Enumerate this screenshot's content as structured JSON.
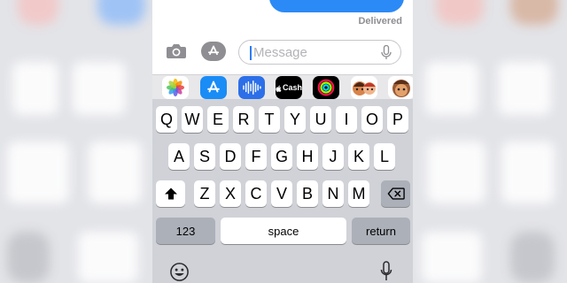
{
  "thread": {
    "status": "Delivered"
  },
  "composer": {
    "placeholder": "Message",
    "camera_icon": "camera-icon",
    "apps_icon": "app-store-icon",
    "mic_icon": "microphone-icon"
  },
  "app_drawer": {
    "apps": [
      {
        "name": "photos",
        "icon": "photos-icon"
      },
      {
        "name": "app-store",
        "icon": "app-store-icon"
      },
      {
        "name": "audio-message",
        "icon": "waveform-icon"
      },
      {
        "name": "apple-cash",
        "icon": "apple-cash-icon",
        "label": "Cash"
      },
      {
        "name": "activity",
        "icon": "activity-rings-icon"
      },
      {
        "name": "memoji-stickers",
        "icon": "memoji-icon"
      },
      {
        "name": "animoji",
        "icon": "animoji-icon"
      }
    ]
  },
  "keyboard": {
    "row1": [
      "Q",
      "W",
      "E",
      "R",
      "T",
      "Y",
      "U",
      "I",
      "O",
      "P"
    ],
    "row2": [
      "A",
      "S",
      "D",
      "F",
      "G",
      "H",
      "J",
      "K",
      "L"
    ],
    "row3": [
      "Z",
      "X",
      "C",
      "V",
      "B",
      "N",
      "M"
    ],
    "numbers_label": "123",
    "space_label": "space",
    "return_label": "return",
    "shift_icon": "shift-icon",
    "delete_icon": "delete-icon",
    "emoji_icon": "emoji-icon",
    "dictation_icon": "microphone-icon"
  },
  "colors": {
    "accent": "#2c8af6",
    "keyboard_bg": "#d0d2d8",
    "special_key": "#acb0b9"
  }
}
